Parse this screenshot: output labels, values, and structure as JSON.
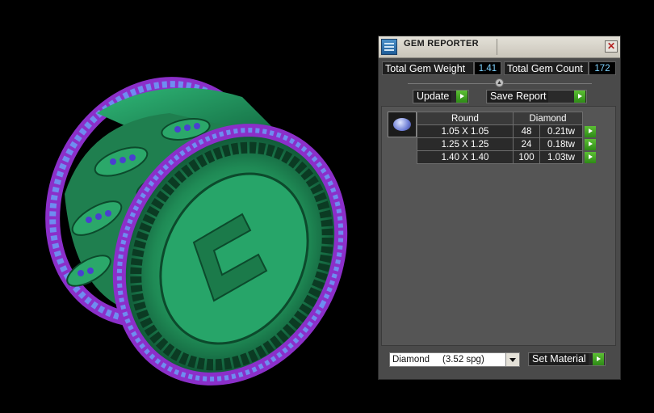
{
  "panel": {
    "title": "GEM REPORTER",
    "close_glyph": "✕",
    "total_weight_label": "Total Gem Weight",
    "total_weight_value": "1.41",
    "total_count_label": "Total Gem Count",
    "total_count_value": "172",
    "update_label": "Update",
    "save_report_label": "Save Report",
    "table": {
      "shape_header": "Round",
      "material_header": "Diamond",
      "rows": [
        {
          "size": "1.05 X 1.05",
          "count": "48",
          "weight": "0.21tw"
        },
        {
          "size": "1.25 X 1.25",
          "count": "24",
          "weight": "0.18tw"
        },
        {
          "size": "1.40 X 1.40",
          "count": "100",
          "weight": "1.03tw"
        }
      ]
    },
    "material_select_value": "Diamond     (3.52 spg)",
    "set_material_label": "Set Material"
  },
  "colors": {
    "accent_green": "#3aa020",
    "ring_green": "#2aa368",
    "ring_purple": "#8b2fc9",
    "gem_blue": "#6f8cf0"
  }
}
